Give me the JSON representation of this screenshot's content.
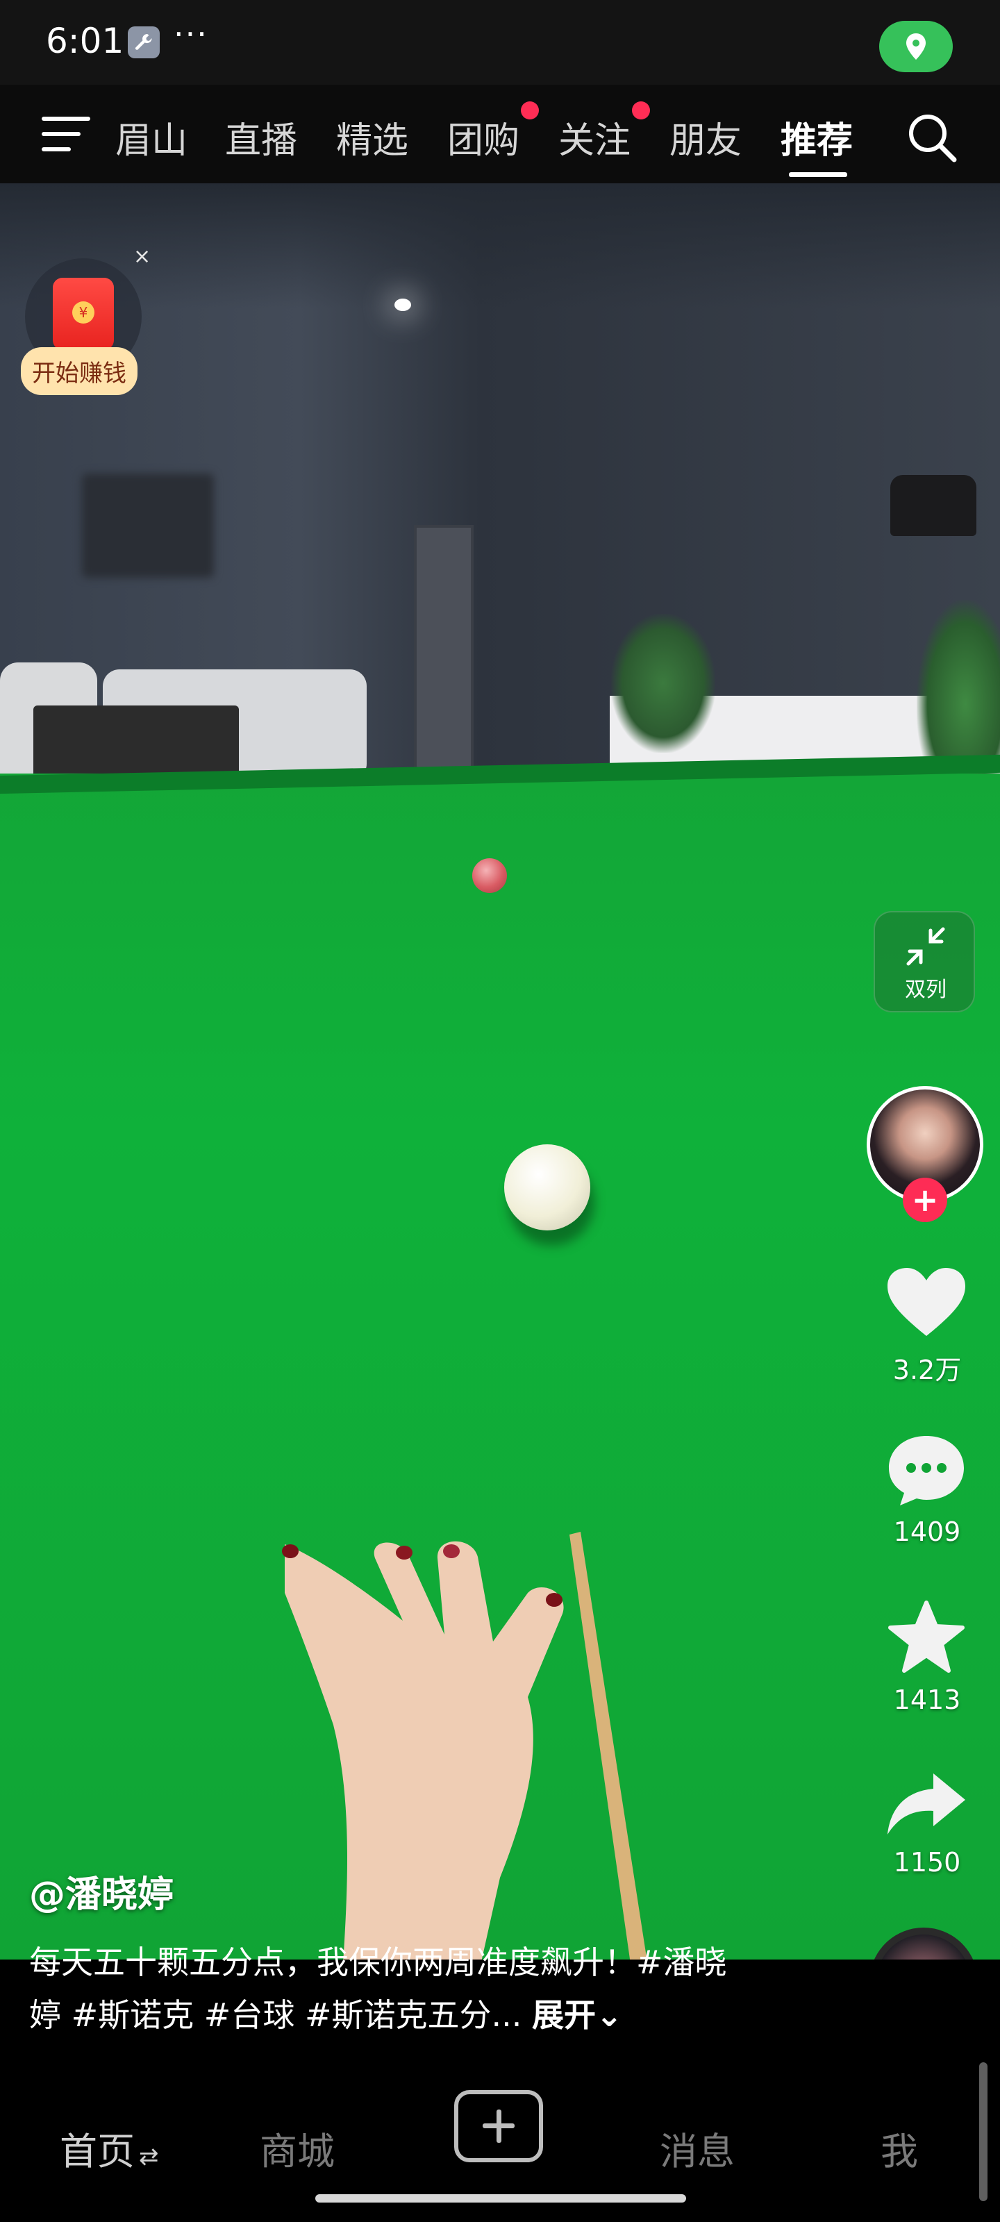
{
  "status_bar": {
    "time": "6:01",
    "dots": "···",
    "icons": [
      "wrench-icon",
      "location-icon"
    ]
  },
  "top_nav": {
    "tabs": [
      {
        "label": "眉山",
        "active": false,
        "badge": false
      },
      {
        "label": "直播",
        "active": false,
        "badge": false
      },
      {
        "label": "精选",
        "active": false,
        "badge": false
      },
      {
        "label": "团购",
        "active": false,
        "badge": true
      },
      {
        "label": "关注",
        "active": false,
        "badge": true
      },
      {
        "label": "朋友",
        "active": false,
        "badge": false
      },
      {
        "label": "推荐",
        "active": true,
        "badge": false
      }
    ],
    "icons": [
      "menu-icon",
      "search-icon"
    ]
  },
  "promo": {
    "label": "开始赚钱",
    "close": "×"
  },
  "right_rail": {
    "dual_column_label": "双列",
    "likes": "3.2万",
    "comments": "1409",
    "favorites": "1413",
    "shares": "1150",
    "follow_symbol": "+"
  },
  "video": {
    "author": "@潘晓婷",
    "caption": "每天五十颗五分点，我保你两周准度飙升！#潘晓婷 #斯诺克 #台球 #斯诺克五分...",
    "expand": "展开"
  },
  "bottom_nav": {
    "tabs": [
      {
        "label": "首页",
        "active": true
      },
      {
        "label": "商城",
        "active": false
      },
      {
        "label": "消息",
        "active": false
      },
      {
        "label": "我",
        "active": false
      }
    ],
    "swap_symbol": "⇄"
  },
  "colors": {
    "felt_green": "#10a435",
    "like_red": "#fe2c55",
    "badge_red": "#ff2d55",
    "location_green": "#36c15a"
  }
}
